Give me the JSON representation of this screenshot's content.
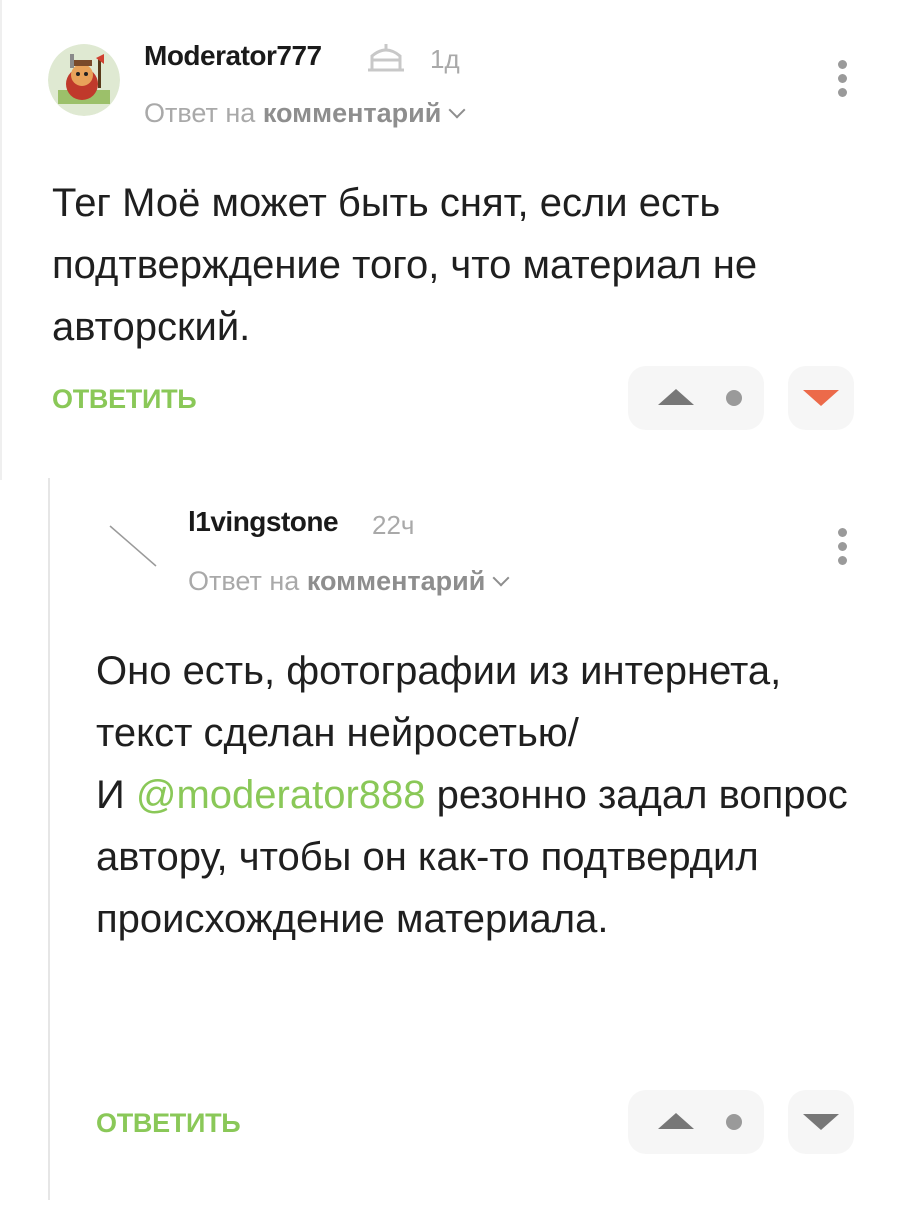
{
  "comments": [
    {
      "author": "Moderator777",
      "time": "1д",
      "reply_prefix": "Ответ на",
      "reply_target": "комментарий",
      "text": "Тег Моё может быть снят, если есть подтверждение того, что материал не авторский.",
      "reply_label": "ОТВЕТИТЬ",
      "downvoted": true
    },
    {
      "author": "l1vingstone",
      "time": "22ч",
      "reply_prefix": "Ответ на",
      "reply_target": "комментарий",
      "text_line1": "Оно есть, фотографии из интернета, текст сделан нейросетью/",
      "text_line2_prefix": "И",
      "mention": "@moderator888",
      "text_line2_suffix": "резонно задал вопрос автору, чтобы он как-то подтвердил происхождение материала.",
      "reply_label": "ОТВЕТИТЬ",
      "downvoted": false
    }
  ],
  "colors": {
    "accent_green": "#8ac858",
    "downvote_active": "#ec6a4a",
    "muted_text": "#a9a9a9"
  }
}
